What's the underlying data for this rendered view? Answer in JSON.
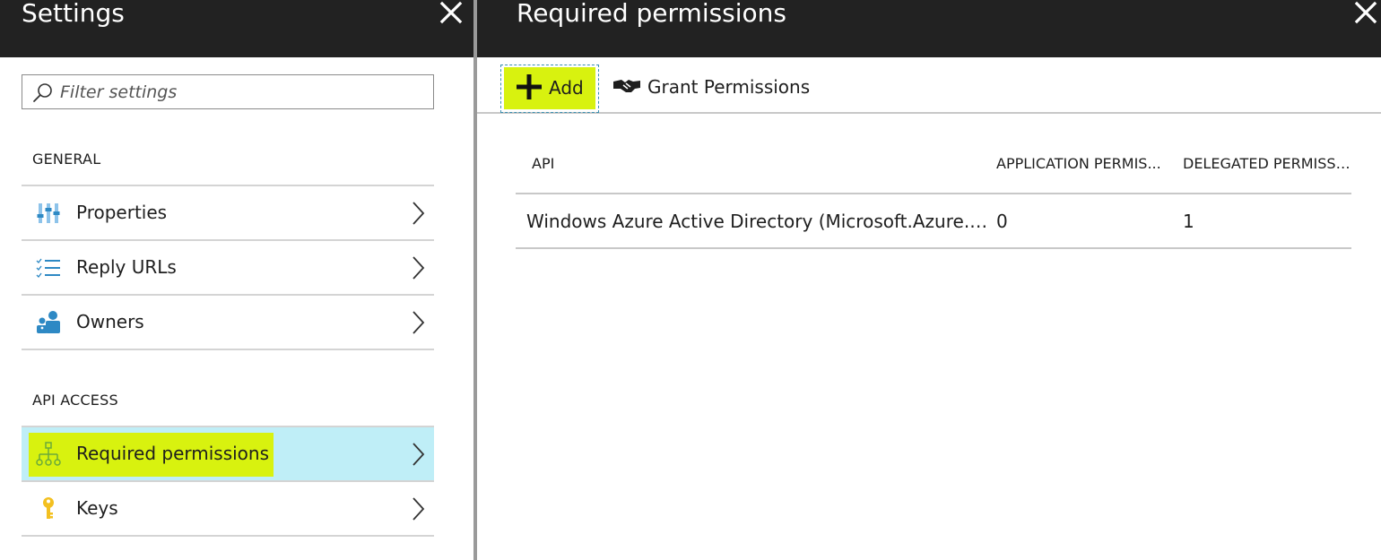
{
  "settings_blade": {
    "title": "Settings",
    "close_icon": "close-icon",
    "filter": {
      "placeholder": "Filter settings",
      "value": ""
    },
    "sections": [
      {
        "title": "GENERAL",
        "items": [
          {
            "label": "Properties",
            "icon": "properties-sliders-icon"
          },
          {
            "label": "Reply URLs",
            "icon": "checklist-icon"
          },
          {
            "label": "Owners",
            "icon": "owners-icon"
          }
        ]
      },
      {
        "title": "API ACCESS",
        "items": [
          {
            "label": "Required permissions",
            "icon": "hierarchy-icon",
            "selected": true
          },
          {
            "label": "Keys",
            "icon": "key-icon"
          }
        ]
      }
    ]
  },
  "permissions_blade": {
    "title": "Required permissions",
    "close_icon": "close-icon",
    "toolbar": {
      "add_label": "Add",
      "grant_label": "Grant Permissions"
    },
    "table": {
      "headers": [
        "API",
        "APPLICATION PERMIS...",
        "DELEGATED PERMISSI..."
      ],
      "rows": [
        [
          "Windows Azure Active Directory (Microsoft.Azure.Act...",
          "0",
          "1"
        ]
      ]
    }
  },
  "colors": {
    "header_bg": "#222222",
    "highlight": "#d8f20f",
    "selected_row": "#bfeef7",
    "icon_blue": "#2e89c4",
    "icon_green": "#6aaa3a",
    "key_yellow": "#f3c020"
  }
}
